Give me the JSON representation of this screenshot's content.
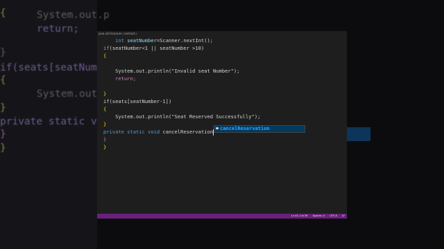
{
  "background": {
    "lines": [
      "    System.out.p",
      "    return;",
      "",
      "}",
      "if(seats[seatNumb",
      "{",
      "    System.out.p",
      "}",
      "private static vo",
      "}",
      "}"
    ]
  },
  "editor": {
    "breadcrumb": "java.util.Scanner;  contract.⟩",
    "code": {
      "l1_type": "int",
      "l1_var": "seatNumber",
      "l1_rest": "=Scanner.nextInt();",
      "l2_if": "if",
      "l2_cond": "(seatNumber<1 || seatNumber >10)",
      "l3": "{",
      "l5": "System.out.println(\"Invalid seat Number\");",
      "l6": "return;",
      "l8": "}",
      "l9": "if(seats[seatNumber-1])",
      "l10": "{",
      "l11": "System.out.println(\"Seat Reserved Successfully\");",
      "l12": "}",
      "l13_mods": "private static void",
      "l13_name": "cancelReservation",
      "l14": "}",
      "l15": "}"
    },
    "suggestion": {
      "label": "cancelReservation",
      "icon": "abc-word-icon"
    },
    "statusbar": {
      "position": "Ln 45, Col 36",
      "spaces": "Spaces: 4",
      "encoding": "UTF-8",
      "eol": "LF"
    }
  },
  "colors": {
    "statusbar": "#68217a",
    "editor_bg": "#1e1e1e",
    "suggest_highlight": "#04395e"
  }
}
